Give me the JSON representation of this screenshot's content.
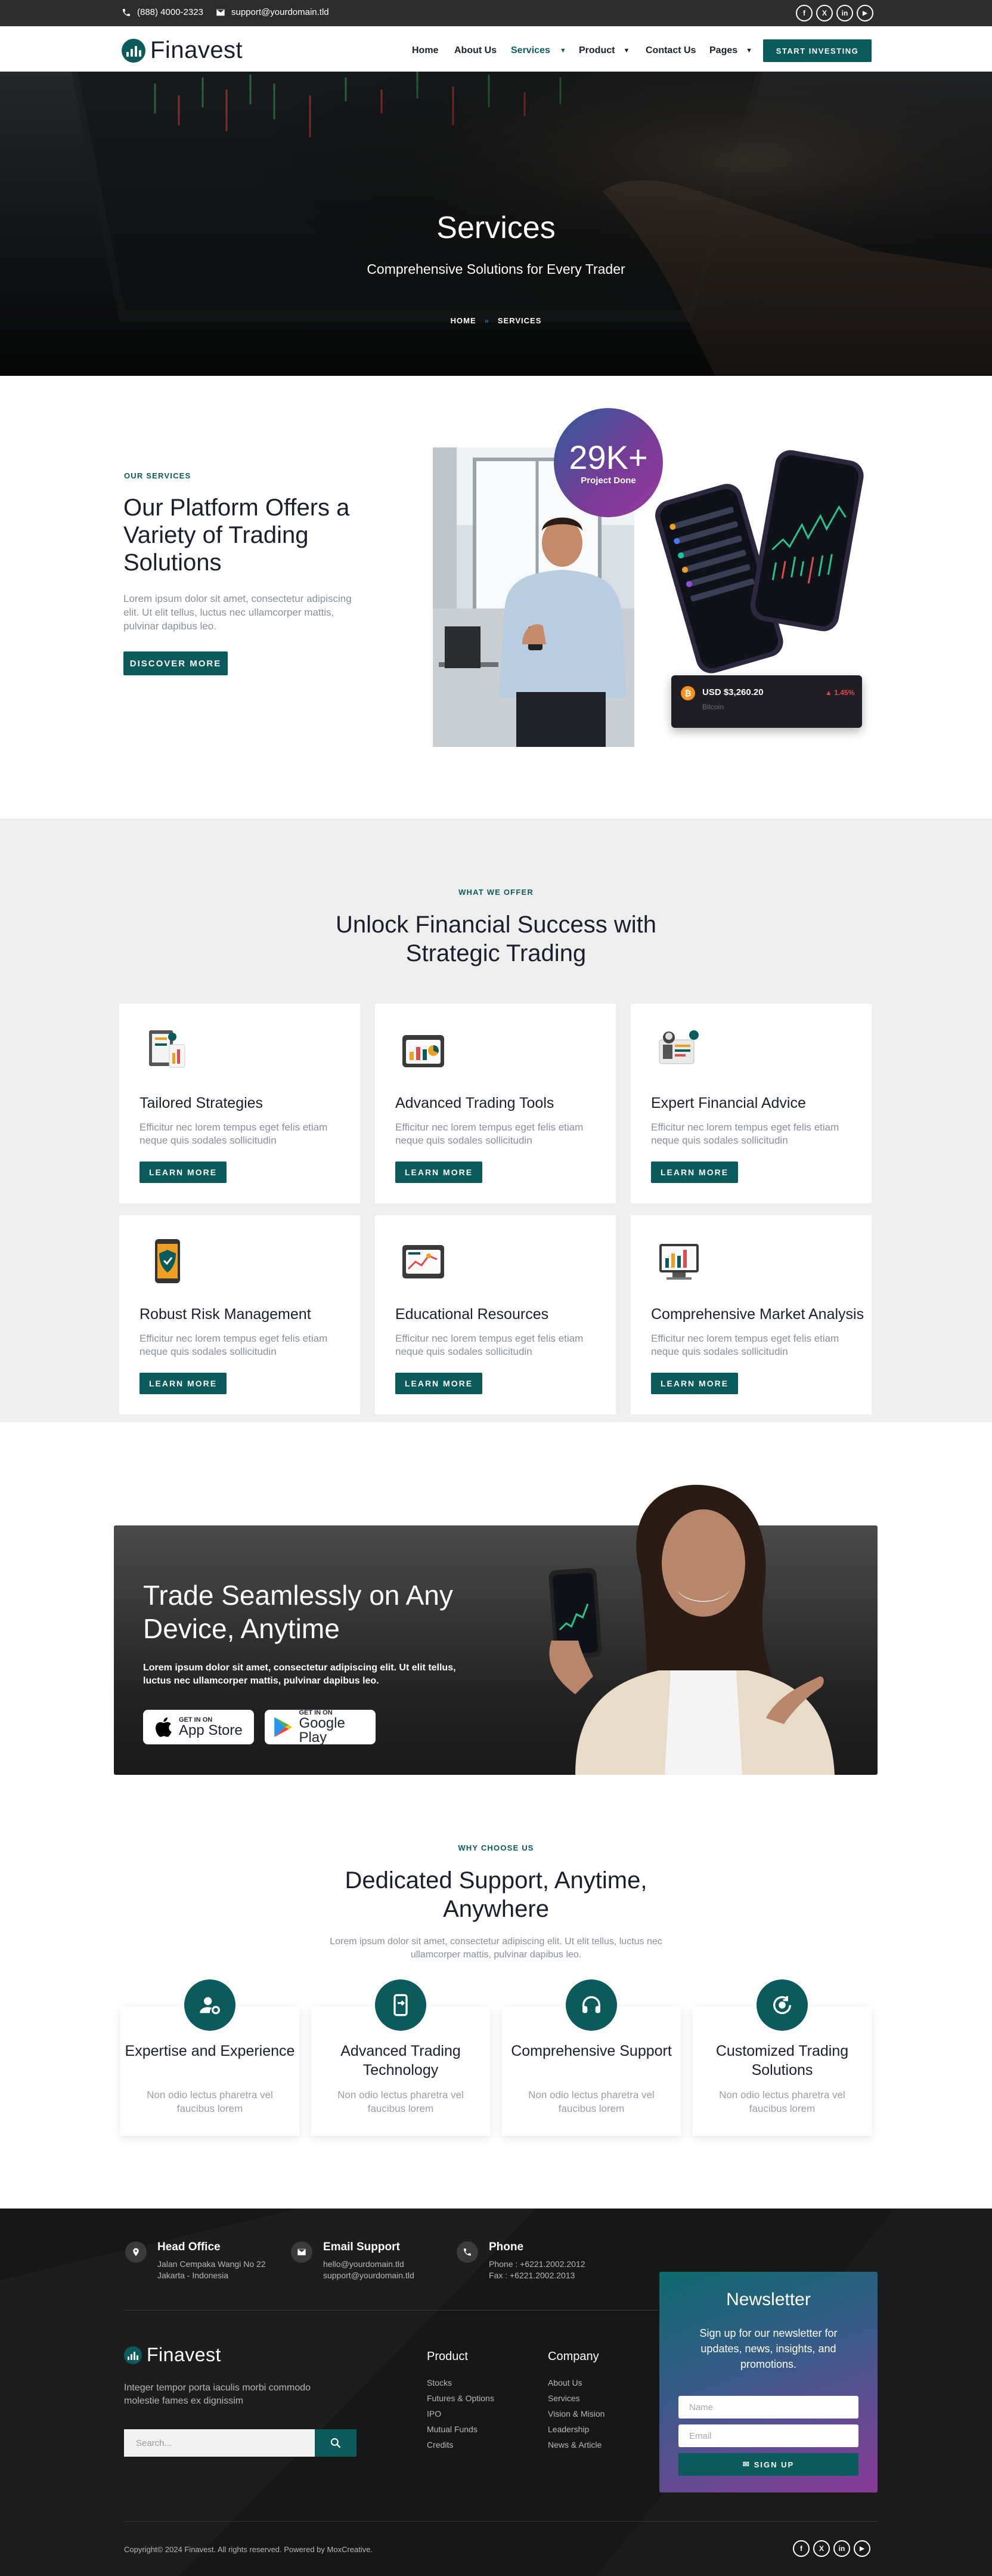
{
  "topbar": {
    "phone": "(888) 4000-2323",
    "email": "support@yourdomain.tld",
    "social": [
      "f",
      "X",
      "in",
      "▶"
    ]
  },
  "nav": {
    "logo": "Finavest",
    "items": [
      "Home",
      "About Us",
      "Services",
      "Product",
      "Contact Us",
      "Pages"
    ],
    "cta": "START INVESTING"
  },
  "hero": {
    "title": "Services",
    "subtitle": "Comprehensive Solutions for Every Trader",
    "breadcrumb_home": "HOME",
    "breadcrumb_sep": "»",
    "breadcrumb_current": "SERVICES"
  },
  "platform": {
    "eyebrow": "OUR SERVICES",
    "title": "Our Platform Offers a Variety of Trading Solutions",
    "desc": "Lorem ipsum dolor sit amet, consectetur adipiscing elit. Ut elit tellus, luctus nec ullamcorper mattis, pulvinar dapibus leo.",
    "button": "DISCOVER MORE",
    "stat_value": "29K+",
    "stat_label": "Project Done",
    "ticker_label": "USD $3,260.20",
    "ticker_change": "▲ 1.45%",
    "ticker_sub": "Bitcoin"
  },
  "offer": {
    "eyebrow": "WHAT WE OFFER",
    "title": "Unlock Financial Success with Strategic Trading",
    "cards": [
      {
        "title": "Tailored Strategies",
        "desc": "Efficitur nec lorem tempus eget felis etiam neque quis sodales sollicitudin",
        "button": "LEARN MORE",
        "icon": "strategy-icon"
      },
      {
        "title": "Advanced Trading Tools",
        "desc": "Efficitur nec lorem tempus eget felis etiam neque quis sodales sollicitudin",
        "button": "LEARN MORE",
        "icon": "trading-tools-icon"
      },
      {
        "title": "Expert Financial Advice",
        "desc": "Efficitur nec lorem tempus eget felis etiam neque quis sodales sollicitudin",
        "button": "LEARN MORE",
        "icon": "advice-icon"
      },
      {
        "title": "Robust Risk Management",
        "desc": "Efficitur nec lorem tempus eget felis etiam neque quis sodales sollicitudin",
        "button": "LEARN MORE",
        "icon": "shield-phone-icon"
      },
      {
        "title": "Educational Resources",
        "desc": "Efficitur nec lorem tempus eget felis etiam neque quis sodales sollicitudin",
        "button": "LEARN MORE",
        "icon": "education-icon"
      },
      {
        "title": "Comprehensive Market Analysis",
        "desc": "Efficitur nec lorem tempus eget felis etiam neque quis sodales sollicitudin",
        "button": "LEARN MORE",
        "icon": "analysis-icon"
      }
    ]
  },
  "app": {
    "title": "Trade Seamlessly on Any Device, Anytime",
    "desc": "Lorem ipsum dolor sit amet, consectetur adipiscing elit. Ut elit tellus, luctus nec ullamcorper mattis, pulvinar dapibus leo.",
    "appstore_small": "GET IN ON",
    "appstore_big": "App Store",
    "gplay_small": "GET IN ON",
    "gplay_big": "Google Play"
  },
  "why": {
    "eyebrow": "WHY CHOOSE US",
    "title": "Dedicated Support, Anytime, Anywhere",
    "desc": "Lorem ipsum dolor sit amet, consectetur adipiscing elit. Ut elit tellus, luctus nec ullamcorper mattis, pulvinar dapibus leo.",
    "cards": [
      {
        "title": "Expertise and Experience",
        "desc": "Non odio lectus pharetra vel faucibus lorem"
      },
      {
        "title": "Advanced Trading Technology",
        "desc": "Non odio lectus pharetra vel faucibus lorem"
      },
      {
        "title": "Comprehensive Support",
        "desc": "Non odio lectus pharetra vel faucibus lorem"
      },
      {
        "title": "Customized Trading Solutions",
        "desc": "Non odio lectus pharetra vel faucibus lorem"
      }
    ]
  },
  "footer": {
    "office_title": "Head Office",
    "office_line1": "Jalan Cempaka Wangi No 22",
    "office_line2": "Jakarta - Indonesia",
    "email_title": "Email Support",
    "email_line1": "hello@yourdomain.tld",
    "email_line2": "support@yourdomain.tld",
    "phone_title": "Phone",
    "phone_line1": "Phone : +6221.2002.2012",
    "phone_line2": "Fax : +6221.2002.2013",
    "logo": "Finavest",
    "about": "Integer tempor porta iaculis morbi commodo molestie fames ex dignissim",
    "search_placeholder": "Search...",
    "product_title": "Product",
    "product_links": [
      "Stocks",
      "Futures & Options",
      "IPO",
      "Mutual Funds",
      "Credits"
    ],
    "company_title": "Company",
    "company_links": [
      "About Us",
      "Services",
      "Vision & Mision",
      "Leadership",
      "News & Article"
    ],
    "newsletter_title": "Newsletter",
    "newsletter_desc": "Sign up for our newsletter for updates, news, insights, and promotions.",
    "name_placeholder": "Name",
    "email_placeholder": "Email",
    "signup": "SIGN UP",
    "copyright": "Copyright© 2024 Finavest. All rights reserved. Powered by MoxCreative."
  },
  "colors": {
    "primary": "#0b5a5c",
    "dark": "#171717",
    "purple": "#7a3a96",
    "light_bg": "#efefef"
  }
}
